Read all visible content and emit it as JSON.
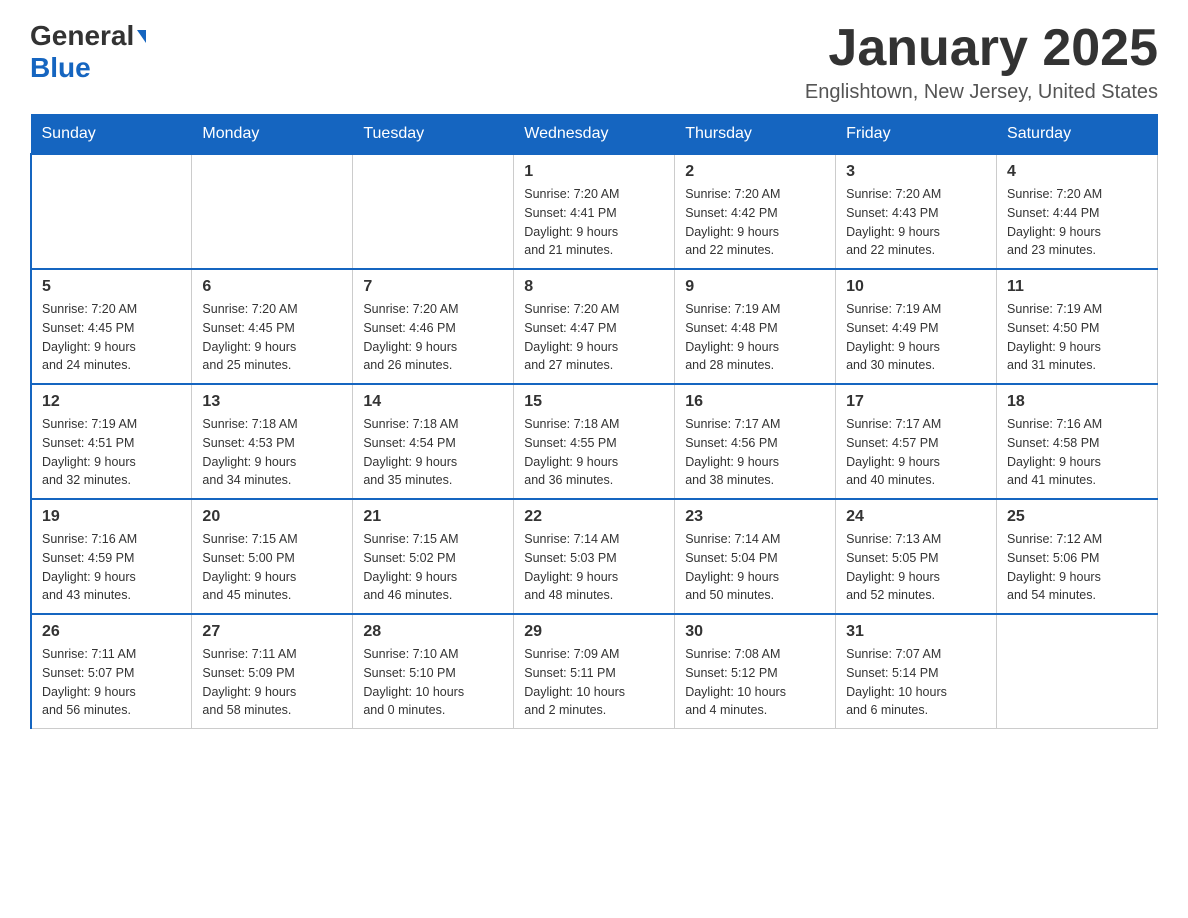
{
  "header": {
    "logo_general": "General",
    "logo_blue": "Blue",
    "month_title": "January 2025",
    "location": "Englishtown, New Jersey, United States"
  },
  "days_of_week": [
    "Sunday",
    "Monday",
    "Tuesday",
    "Wednesday",
    "Thursday",
    "Friday",
    "Saturday"
  ],
  "weeks": [
    [
      {
        "day": "",
        "info": ""
      },
      {
        "day": "",
        "info": ""
      },
      {
        "day": "",
        "info": ""
      },
      {
        "day": "1",
        "info": "Sunrise: 7:20 AM\nSunset: 4:41 PM\nDaylight: 9 hours\nand 21 minutes."
      },
      {
        "day": "2",
        "info": "Sunrise: 7:20 AM\nSunset: 4:42 PM\nDaylight: 9 hours\nand 22 minutes."
      },
      {
        "day": "3",
        "info": "Sunrise: 7:20 AM\nSunset: 4:43 PM\nDaylight: 9 hours\nand 22 minutes."
      },
      {
        "day": "4",
        "info": "Sunrise: 7:20 AM\nSunset: 4:44 PM\nDaylight: 9 hours\nand 23 minutes."
      }
    ],
    [
      {
        "day": "5",
        "info": "Sunrise: 7:20 AM\nSunset: 4:45 PM\nDaylight: 9 hours\nand 24 minutes."
      },
      {
        "day": "6",
        "info": "Sunrise: 7:20 AM\nSunset: 4:45 PM\nDaylight: 9 hours\nand 25 minutes."
      },
      {
        "day": "7",
        "info": "Sunrise: 7:20 AM\nSunset: 4:46 PM\nDaylight: 9 hours\nand 26 minutes."
      },
      {
        "day": "8",
        "info": "Sunrise: 7:20 AM\nSunset: 4:47 PM\nDaylight: 9 hours\nand 27 minutes."
      },
      {
        "day": "9",
        "info": "Sunrise: 7:19 AM\nSunset: 4:48 PM\nDaylight: 9 hours\nand 28 minutes."
      },
      {
        "day": "10",
        "info": "Sunrise: 7:19 AM\nSunset: 4:49 PM\nDaylight: 9 hours\nand 30 minutes."
      },
      {
        "day": "11",
        "info": "Sunrise: 7:19 AM\nSunset: 4:50 PM\nDaylight: 9 hours\nand 31 minutes."
      }
    ],
    [
      {
        "day": "12",
        "info": "Sunrise: 7:19 AM\nSunset: 4:51 PM\nDaylight: 9 hours\nand 32 minutes."
      },
      {
        "day": "13",
        "info": "Sunrise: 7:18 AM\nSunset: 4:53 PM\nDaylight: 9 hours\nand 34 minutes."
      },
      {
        "day": "14",
        "info": "Sunrise: 7:18 AM\nSunset: 4:54 PM\nDaylight: 9 hours\nand 35 minutes."
      },
      {
        "day": "15",
        "info": "Sunrise: 7:18 AM\nSunset: 4:55 PM\nDaylight: 9 hours\nand 36 minutes."
      },
      {
        "day": "16",
        "info": "Sunrise: 7:17 AM\nSunset: 4:56 PM\nDaylight: 9 hours\nand 38 minutes."
      },
      {
        "day": "17",
        "info": "Sunrise: 7:17 AM\nSunset: 4:57 PM\nDaylight: 9 hours\nand 40 minutes."
      },
      {
        "day": "18",
        "info": "Sunrise: 7:16 AM\nSunset: 4:58 PM\nDaylight: 9 hours\nand 41 minutes."
      }
    ],
    [
      {
        "day": "19",
        "info": "Sunrise: 7:16 AM\nSunset: 4:59 PM\nDaylight: 9 hours\nand 43 minutes."
      },
      {
        "day": "20",
        "info": "Sunrise: 7:15 AM\nSunset: 5:00 PM\nDaylight: 9 hours\nand 45 minutes."
      },
      {
        "day": "21",
        "info": "Sunrise: 7:15 AM\nSunset: 5:02 PM\nDaylight: 9 hours\nand 46 minutes."
      },
      {
        "day": "22",
        "info": "Sunrise: 7:14 AM\nSunset: 5:03 PM\nDaylight: 9 hours\nand 48 minutes."
      },
      {
        "day": "23",
        "info": "Sunrise: 7:14 AM\nSunset: 5:04 PM\nDaylight: 9 hours\nand 50 minutes."
      },
      {
        "day": "24",
        "info": "Sunrise: 7:13 AM\nSunset: 5:05 PM\nDaylight: 9 hours\nand 52 minutes."
      },
      {
        "day": "25",
        "info": "Sunrise: 7:12 AM\nSunset: 5:06 PM\nDaylight: 9 hours\nand 54 minutes."
      }
    ],
    [
      {
        "day": "26",
        "info": "Sunrise: 7:11 AM\nSunset: 5:07 PM\nDaylight: 9 hours\nand 56 minutes."
      },
      {
        "day": "27",
        "info": "Sunrise: 7:11 AM\nSunset: 5:09 PM\nDaylight: 9 hours\nand 58 minutes."
      },
      {
        "day": "28",
        "info": "Sunrise: 7:10 AM\nSunset: 5:10 PM\nDaylight: 10 hours\nand 0 minutes."
      },
      {
        "day": "29",
        "info": "Sunrise: 7:09 AM\nSunset: 5:11 PM\nDaylight: 10 hours\nand 2 minutes."
      },
      {
        "day": "30",
        "info": "Sunrise: 7:08 AM\nSunset: 5:12 PM\nDaylight: 10 hours\nand 4 minutes."
      },
      {
        "day": "31",
        "info": "Sunrise: 7:07 AM\nSunset: 5:14 PM\nDaylight: 10 hours\nand 6 minutes."
      },
      {
        "day": "",
        "info": ""
      }
    ]
  ]
}
